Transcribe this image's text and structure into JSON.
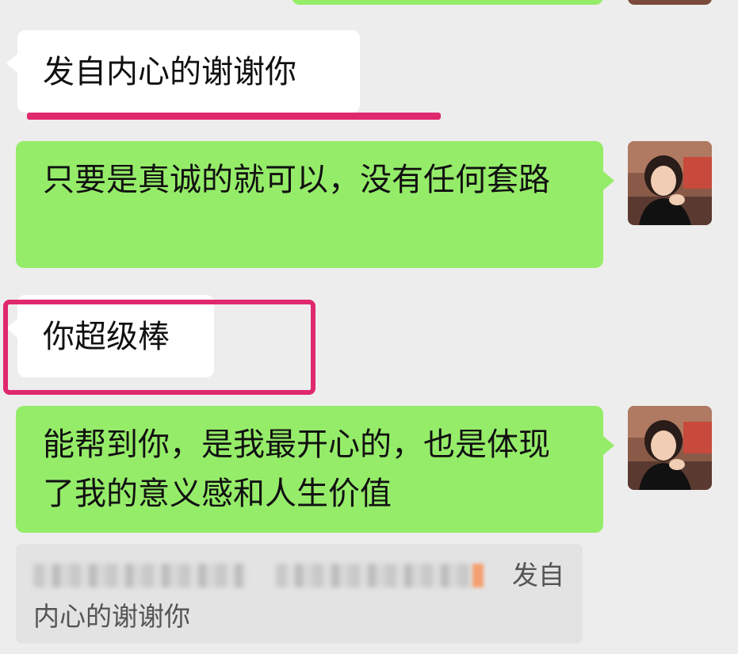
{
  "conversation": {
    "messages": [
      {
        "side": "received",
        "text": "发自内心的谢谢你"
      },
      {
        "side": "sent",
        "text": "只要是真诚的就可以，没有任何套路"
      },
      {
        "side": "received",
        "text": "你超级棒"
      },
      {
        "side": "sent",
        "text": "能帮到你，是我最开心的，也是体现了我的意义感和人生价值"
      }
    ],
    "quote": {
      "line1_tail": "发自",
      "line2": "内心的谢谢你"
    }
  },
  "colors": {
    "chat_background": "#ededed",
    "sent_bubble": "#95ec69",
    "received_bubble": "#ffffff",
    "annotation": "#e0286e"
  },
  "icons": {
    "avatar": "user-avatar-photo"
  }
}
